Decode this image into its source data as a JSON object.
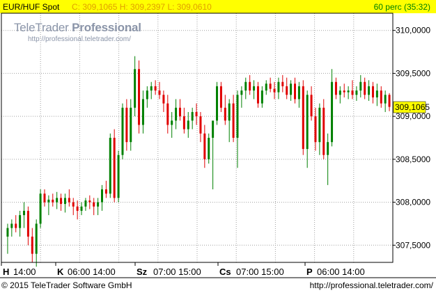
{
  "header": {
    "symbol": "EUR/HUF Spot",
    "ohlc": "C: 309,1065 H: 309,2397 L: 309,0610",
    "interval": "60 perc (35:32)"
  },
  "logo": {
    "brand_prefix": "TeleTrader",
    "brand_suffix": "Professional",
    "url": "http://professional.teletrader.com/"
  },
  "footer": {
    "copyright": "© 2015 TeleTrader Software GmbH",
    "url": "http://professional.teletrader.com/"
  },
  "colors": {
    "up": "#008000",
    "down": "#e00000",
    "grid": "#a0a0a0",
    "last_price_bg": "#ffff00",
    "header_bg": "#ffff00",
    "header_ohlc": "#e0a000"
  },
  "chart_data": {
    "type": "candlestick",
    "ylim": [
      307.3,
      310.2
    ],
    "y_ticks": [
      "310,0000",
      "309,5000",
      "309,0000",
      "308,5000",
      "308,0000",
      "307,5000"
    ],
    "y_tick_values": [
      310.0,
      309.5,
      309.0,
      308.5,
      308.0,
      307.5
    ],
    "last_price_label": "309,1065",
    "last_price": 309.1065,
    "x_labels": [
      {
        "day": "H",
        "times": "14:00"
      },
      {
        "day": "K",
        "times": "06:00 14:00"
      },
      {
        "day": "Sz",
        "times": "07:00 15:00"
      },
      {
        "day": "Cs",
        "times": "07:00 15:00"
      },
      {
        "day": "P",
        "times": "06:00 14:00"
      }
    ],
    "candles": [
      [
        307.6,
        307.75,
        307.4,
        307.7
      ],
      [
        307.7,
        307.8,
        307.6,
        307.75
      ],
      [
        307.75,
        307.85,
        307.65,
        307.7
      ],
      [
        307.7,
        307.9,
        307.6,
        307.85
      ],
      [
        307.85,
        308.0,
        307.7,
        307.9
      ],
      [
        307.9,
        307.95,
        307.5,
        307.6
      ],
      [
        307.6,
        307.7,
        307.3,
        307.4
      ],
      [
        307.4,
        307.8,
        307.25,
        307.75
      ],
      [
        307.75,
        308.15,
        307.7,
        308.1
      ],
      [
        308.1,
        308.15,
        307.95,
        308.0
      ],
      [
        308.0,
        308.08,
        307.85,
        308.03
      ],
      [
        308.03,
        308.1,
        307.95,
        308.0
      ],
      [
        308.0,
        308.12,
        307.92,
        308.05
      ],
      [
        308.05,
        308.1,
        307.9,
        307.98
      ],
      [
        307.98,
        308.1,
        307.88,
        308.05
      ],
      [
        308.05,
        308.15,
        307.95,
        308.0
      ],
      [
        308.0,
        308.05,
        307.85,
        307.95
      ],
      [
        307.95,
        308.02,
        307.8,
        307.9
      ],
      [
        307.9,
        308.0,
        307.85,
        307.95
      ],
      [
        307.95,
        308.05,
        307.9,
        308.02
      ],
      [
        308.02,
        308.08,
        307.92,
        308.0
      ],
      [
        308.0,
        308.05,
        307.85,
        307.95
      ],
      [
        307.95,
        308.05,
        307.85,
        308.0
      ],
      [
        308.0,
        308.2,
        307.9,
        308.15
      ],
      [
        308.15,
        308.25,
        308.05,
        308.1
      ],
      [
        308.1,
        308.8,
        308.05,
        308.75
      ],
      [
        308.75,
        308.85,
        308.0,
        308.05
      ],
      [
        308.05,
        308.6,
        308.0,
        308.55
      ],
      [
        308.55,
        309.15,
        308.5,
        309.1
      ],
      [
        309.1,
        309.2,
        308.6,
        308.7
      ],
      [
        308.7,
        309.2,
        308.6,
        309.1
      ],
      [
        309.1,
        309.7,
        309.0,
        309.55
      ],
      [
        309.55,
        309.65,
        308.8,
        308.9
      ],
      [
        308.9,
        309.3,
        308.8,
        309.2
      ],
      [
        309.2,
        309.35,
        309.1,
        309.3
      ],
      [
        309.3,
        309.4,
        309.2,
        309.35
      ],
      [
        309.35,
        309.42,
        309.25,
        309.3
      ],
      [
        309.3,
        309.4,
        309.2,
        309.25
      ],
      [
        309.25,
        309.3,
        309.05,
        309.15
      ],
      [
        309.15,
        309.25,
        308.8,
        308.9
      ],
      [
        308.9,
        309.05,
        308.75,
        308.95
      ],
      [
        308.95,
        309.2,
        308.85,
        309.1
      ],
      [
        309.1,
        309.2,
        308.95,
        309.0
      ],
      [
        309.0,
        309.1,
        308.8,
        308.85
      ],
      [
        308.85,
        309.05,
        308.75,
        308.95
      ],
      [
        308.95,
        309.1,
        308.85,
        309.05
      ],
      [
        309.05,
        309.15,
        308.9,
        309.0
      ],
      [
        309.0,
        309.05,
        308.7,
        308.8
      ],
      [
        308.8,
        308.9,
        308.4,
        308.5
      ],
      [
        308.5,
        308.8,
        308.45,
        308.75
      ],
      [
        308.75,
        308.85,
        308.15,
        308.95
      ],
      [
        308.95,
        309.4,
        308.9,
        309.35
      ],
      [
        309.35,
        309.4,
        309.05,
        309.1
      ],
      [
        309.1,
        309.25,
        308.9,
        308.95
      ],
      [
        308.95,
        309.2,
        308.7,
        309.15
      ],
      [
        309.15,
        309.25,
        308.7,
        308.75
      ],
      [
        308.75,
        309.3,
        308.4,
        309.25
      ],
      [
        309.25,
        309.35,
        309.1,
        309.3
      ],
      [
        309.3,
        309.45,
        309.2,
        309.4
      ],
      [
        309.4,
        309.48,
        309.25,
        309.3
      ],
      [
        309.3,
        309.42,
        309.2,
        309.35
      ],
      [
        309.35,
        309.4,
        309.1,
        309.15
      ],
      [
        309.15,
        309.35,
        309.1,
        309.3
      ],
      [
        309.3,
        309.42,
        309.25,
        309.38
      ],
      [
        309.38,
        309.45,
        309.28,
        309.32
      ],
      [
        309.32,
        309.4,
        309.2,
        309.28
      ],
      [
        309.28,
        309.45,
        309.2,
        309.4
      ],
      [
        309.4,
        309.48,
        309.28,
        309.35
      ],
      [
        309.35,
        309.45,
        309.2,
        309.25
      ],
      [
        309.25,
        309.42,
        309.18,
        309.38
      ],
      [
        309.38,
        309.45,
        309.15,
        309.2
      ],
      [
        309.2,
        309.4,
        309.1,
        309.35
      ],
      [
        309.35,
        309.42,
        308.55,
        308.62
      ],
      [
        308.62,
        309.3,
        308.4,
        309.25
      ],
      [
        309.25,
        309.35,
        308.95,
        309.0
      ],
      [
        309.0,
        309.1,
        308.6,
        308.7
      ],
      [
        308.7,
        309.15,
        308.55,
        309.1
      ],
      [
        309.1,
        309.2,
        308.5,
        308.55
      ],
      [
        308.55,
        308.8,
        308.2,
        308.7
      ],
      [
        308.7,
        309.55,
        308.65,
        309.4
      ],
      [
        309.4,
        309.45,
        309.2,
        309.25
      ],
      [
        309.25,
        309.35,
        309.15,
        309.3
      ],
      [
        309.3,
        309.38,
        309.22,
        309.28
      ],
      [
        309.28,
        309.35,
        309.2,
        309.3
      ],
      [
        309.3,
        309.42,
        309.2,
        309.25
      ],
      [
        309.25,
        309.35,
        309.18,
        309.3
      ],
      [
        309.3,
        309.48,
        309.22,
        309.4
      ],
      [
        309.4,
        309.45,
        309.2,
        309.25
      ],
      [
        309.25,
        309.42,
        309.18,
        309.35
      ],
      [
        309.35,
        309.4,
        309.15,
        309.22
      ],
      [
        309.22,
        309.38,
        309.12,
        309.3
      ],
      [
        309.3,
        309.35,
        309.1,
        309.15
      ],
      [
        309.15,
        309.3,
        309.05,
        309.25
      ],
      [
        309.25,
        309.27,
        309.06,
        309.11
      ]
    ]
  }
}
